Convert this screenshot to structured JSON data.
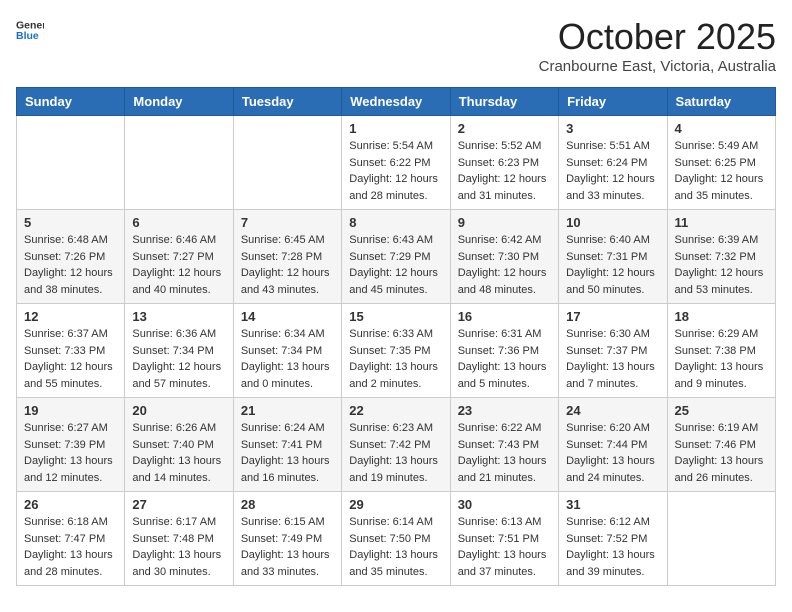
{
  "header": {
    "logo_general": "General",
    "logo_blue": "Blue",
    "month": "October 2025",
    "location": "Cranbourne East, Victoria, Australia"
  },
  "days_of_week": [
    "Sunday",
    "Monday",
    "Tuesday",
    "Wednesday",
    "Thursday",
    "Friday",
    "Saturday"
  ],
  "weeks": [
    [
      {
        "day": "",
        "sunrise": "",
        "sunset": "",
        "daylight": ""
      },
      {
        "day": "",
        "sunrise": "",
        "sunset": "",
        "daylight": ""
      },
      {
        "day": "",
        "sunrise": "",
        "sunset": "",
        "daylight": ""
      },
      {
        "day": "1",
        "sunrise": "Sunrise: 5:54 AM",
        "sunset": "Sunset: 6:22 PM",
        "daylight": "Daylight: 12 hours and 28 minutes."
      },
      {
        "day": "2",
        "sunrise": "Sunrise: 5:52 AM",
        "sunset": "Sunset: 6:23 PM",
        "daylight": "Daylight: 12 hours and 31 minutes."
      },
      {
        "day": "3",
        "sunrise": "Sunrise: 5:51 AM",
        "sunset": "Sunset: 6:24 PM",
        "daylight": "Daylight: 12 hours and 33 minutes."
      },
      {
        "day": "4",
        "sunrise": "Sunrise: 5:49 AM",
        "sunset": "Sunset: 6:25 PM",
        "daylight": "Daylight: 12 hours and 35 minutes."
      }
    ],
    [
      {
        "day": "5",
        "sunrise": "Sunrise: 6:48 AM",
        "sunset": "Sunset: 7:26 PM",
        "daylight": "Daylight: 12 hours and 38 minutes."
      },
      {
        "day": "6",
        "sunrise": "Sunrise: 6:46 AM",
        "sunset": "Sunset: 7:27 PM",
        "daylight": "Daylight: 12 hours and 40 minutes."
      },
      {
        "day": "7",
        "sunrise": "Sunrise: 6:45 AM",
        "sunset": "Sunset: 7:28 PM",
        "daylight": "Daylight: 12 hours and 43 minutes."
      },
      {
        "day": "8",
        "sunrise": "Sunrise: 6:43 AM",
        "sunset": "Sunset: 7:29 PM",
        "daylight": "Daylight: 12 hours and 45 minutes."
      },
      {
        "day": "9",
        "sunrise": "Sunrise: 6:42 AM",
        "sunset": "Sunset: 7:30 PM",
        "daylight": "Daylight: 12 hours and 48 minutes."
      },
      {
        "day": "10",
        "sunrise": "Sunrise: 6:40 AM",
        "sunset": "Sunset: 7:31 PM",
        "daylight": "Daylight: 12 hours and 50 minutes."
      },
      {
        "day": "11",
        "sunrise": "Sunrise: 6:39 AM",
        "sunset": "Sunset: 7:32 PM",
        "daylight": "Daylight: 12 hours and 53 minutes."
      }
    ],
    [
      {
        "day": "12",
        "sunrise": "Sunrise: 6:37 AM",
        "sunset": "Sunset: 7:33 PM",
        "daylight": "Daylight: 12 hours and 55 minutes."
      },
      {
        "day": "13",
        "sunrise": "Sunrise: 6:36 AM",
        "sunset": "Sunset: 7:34 PM",
        "daylight": "Daylight: 12 hours and 57 minutes."
      },
      {
        "day": "14",
        "sunrise": "Sunrise: 6:34 AM",
        "sunset": "Sunset: 7:34 PM",
        "daylight": "Daylight: 13 hours and 0 minutes."
      },
      {
        "day": "15",
        "sunrise": "Sunrise: 6:33 AM",
        "sunset": "Sunset: 7:35 PM",
        "daylight": "Daylight: 13 hours and 2 minutes."
      },
      {
        "day": "16",
        "sunrise": "Sunrise: 6:31 AM",
        "sunset": "Sunset: 7:36 PM",
        "daylight": "Daylight: 13 hours and 5 minutes."
      },
      {
        "day": "17",
        "sunrise": "Sunrise: 6:30 AM",
        "sunset": "Sunset: 7:37 PM",
        "daylight": "Daylight: 13 hours and 7 minutes."
      },
      {
        "day": "18",
        "sunrise": "Sunrise: 6:29 AM",
        "sunset": "Sunset: 7:38 PM",
        "daylight": "Daylight: 13 hours and 9 minutes."
      }
    ],
    [
      {
        "day": "19",
        "sunrise": "Sunrise: 6:27 AM",
        "sunset": "Sunset: 7:39 PM",
        "daylight": "Daylight: 13 hours and 12 minutes."
      },
      {
        "day": "20",
        "sunrise": "Sunrise: 6:26 AM",
        "sunset": "Sunset: 7:40 PM",
        "daylight": "Daylight: 13 hours and 14 minutes."
      },
      {
        "day": "21",
        "sunrise": "Sunrise: 6:24 AM",
        "sunset": "Sunset: 7:41 PM",
        "daylight": "Daylight: 13 hours and 16 minutes."
      },
      {
        "day": "22",
        "sunrise": "Sunrise: 6:23 AM",
        "sunset": "Sunset: 7:42 PM",
        "daylight": "Daylight: 13 hours and 19 minutes."
      },
      {
        "day": "23",
        "sunrise": "Sunrise: 6:22 AM",
        "sunset": "Sunset: 7:43 PM",
        "daylight": "Daylight: 13 hours and 21 minutes."
      },
      {
        "day": "24",
        "sunrise": "Sunrise: 6:20 AM",
        "sunset": "Sunset: 7:44 PM",
        "daylight": "Daylight: 13 hours and 24 minutes."
      },
      {
        "day": "25",
        "sunrise": "Sunrise: 6:19 AM",
        "sunset": "Sunset: 7:46 PM",
        "daylight": "Daylight: 13 hours and 26 minutes."
      }
    ],
    [
      {
        "day": "26",
        "sunrise": "Sunrise: 6:18 AM",
        "sunset": "Sunset: 7:47 PM",
        "daylight": "Daylight: 13 hours and 28 minutes."
      },
      {
        "day": "27",
        "sunrise": "Sunrise: 6:17 AM",
        "sunset": "Sunset: 7:48 PM",
        "daylight": "Daylight: 13 hours and 30 minutes."
      },
      {
        "day": "28",
        "sunrise": "Sunrise: 6:15 AM",
        "sunset": "Sunset: 7:49 PM",
        "daylight": "Daylight: 13 hours and 33 minutes."
      },
      {
        "day": "29",
        "sunrise": "Sunrise: 6:14 AM",
        "sunset": "Sunset: 7:50 PM",
        "daylight": "Daylight: 13 hours and 35 minutes."
      },
      {
        "day": "30",
        "sunrise": "Sunrise: 6:13 AM",
        "sunset": "Sunset: 7:51 PM",
        "daylight": "Daylight: 13 hours and 37 minutes."
      },
      {
        "day": "31",
        "sunrise": "Sunrise: 6:12 AM",
        "sunset": "Sunset: 7:52 PM",
        "daylight": "Daylight: 13 hours and 39 minutes."
      },
      {
        "day": "",
        "sunrise": "",
        "sunset": "",
        "daylight": ""
      }
    ]
  ]
}
